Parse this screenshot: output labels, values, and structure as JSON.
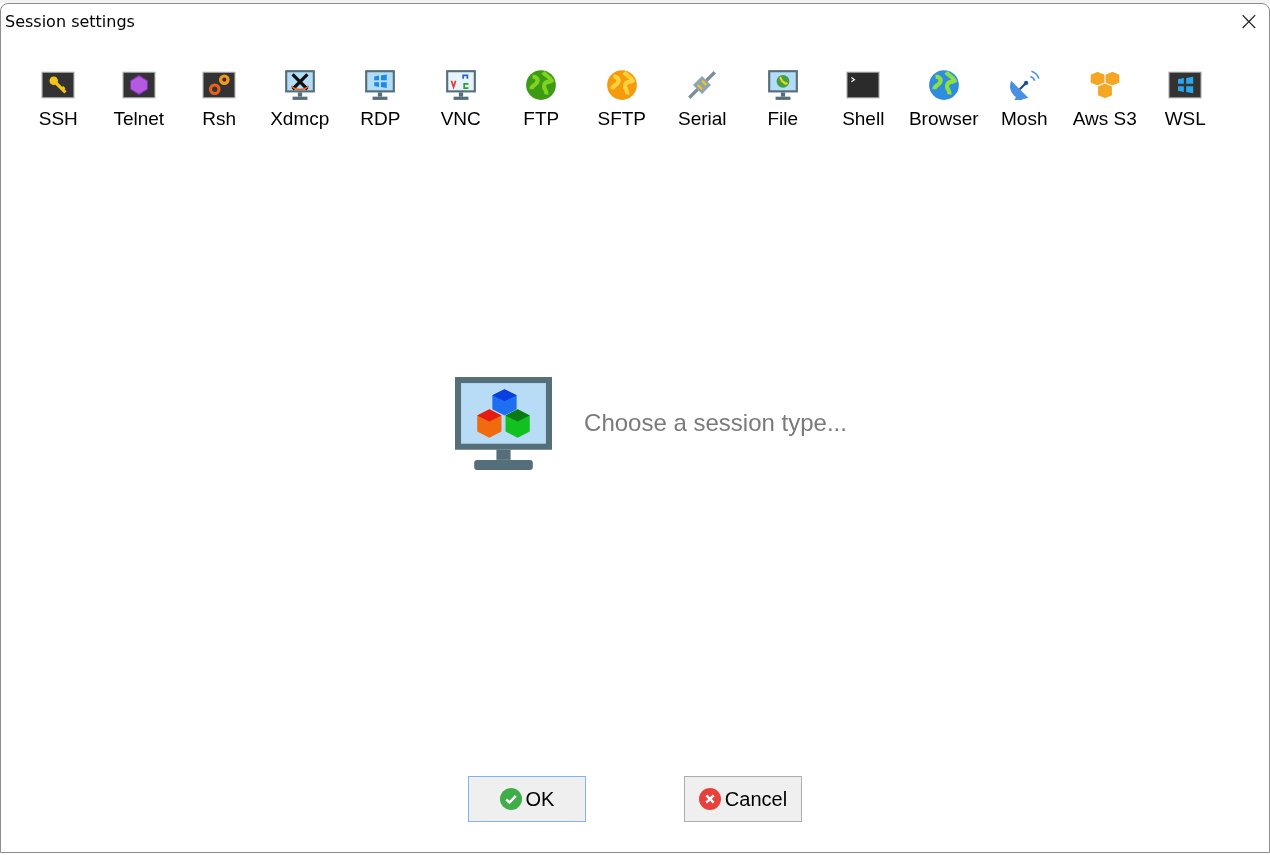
{
  "window": {
    "title": "Session settings",
    "close": "×"
  },
  "session_types": [
    {
      "kind": "ssh",
      "label": "SSH"
    },
    {
      "kind": "telnet",
      "label": "Telnet"
    },
    {
      "kind": "rsh",
      "label": "Rsh"
    },
    {
      "kind": "xdmcp",
      "label": "Xdmcp"
    },
    {
      "kind": "rdp",
      "label": "RDP"
    },
    {
      "kind": "vnc",
      "label": "VNC"
    },
    {
      "kind": "ftp",
      "label": "FTP"
    },
    {
      "kind": "sftp",
      "label": "SFTP"
    },
    {
      "kind": "serial",
      "label": "Serial"
    },
    {
      "kind": "file",
      "label": "File"
    },
    {
      "kind": "shell",
      "label": "Shell"
    },
    {
      "kind": "browser",
      "label": "Browser"
    },
    {
      "kind": "mosh",
      "label": "Mosh"
    },
    {
      "kind": "s3",
      "label": "Aws S3"
    },
    {
      "kind": "wsl",
      "label": "WSL"
    }
  ],
  "prompt": "Choose a session type...",
  "buttons": [
    {
      "kind": "ok",
      "label": "OK",
      "focused": true
    },
    {
      "kind": "cancel",
      "label": "Cancel",
      "focused": false
    }
  ]
}
